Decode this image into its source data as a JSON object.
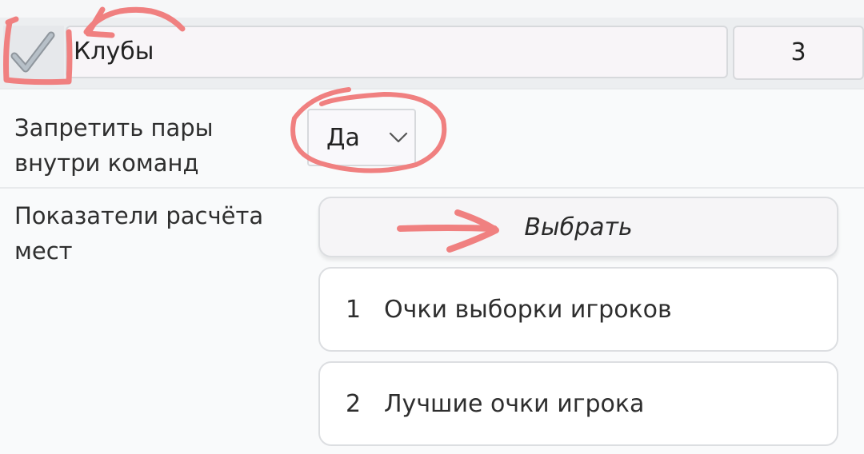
{
  "header": {
    "checked": true,
    "title": "Клубы",
    "count": "3"
  },
  "settings": {
    "forbid_pairs": {
      "label": "Запретить пары\nвнутри команд",
      "value": "Да"
    },
    "ranking": {
      "label": "Показатели расчёта\nмест",
      "choose_label": "Выбрать",
      "items": [
        {
          "index": "1",
          "text": "Очки выборки игроков"
        },
        {
          "index": "2",
          "text": "Лучшие очки игрока"
        }
      ]
    }
  },
  "annotation_color": "#f08080"
}
